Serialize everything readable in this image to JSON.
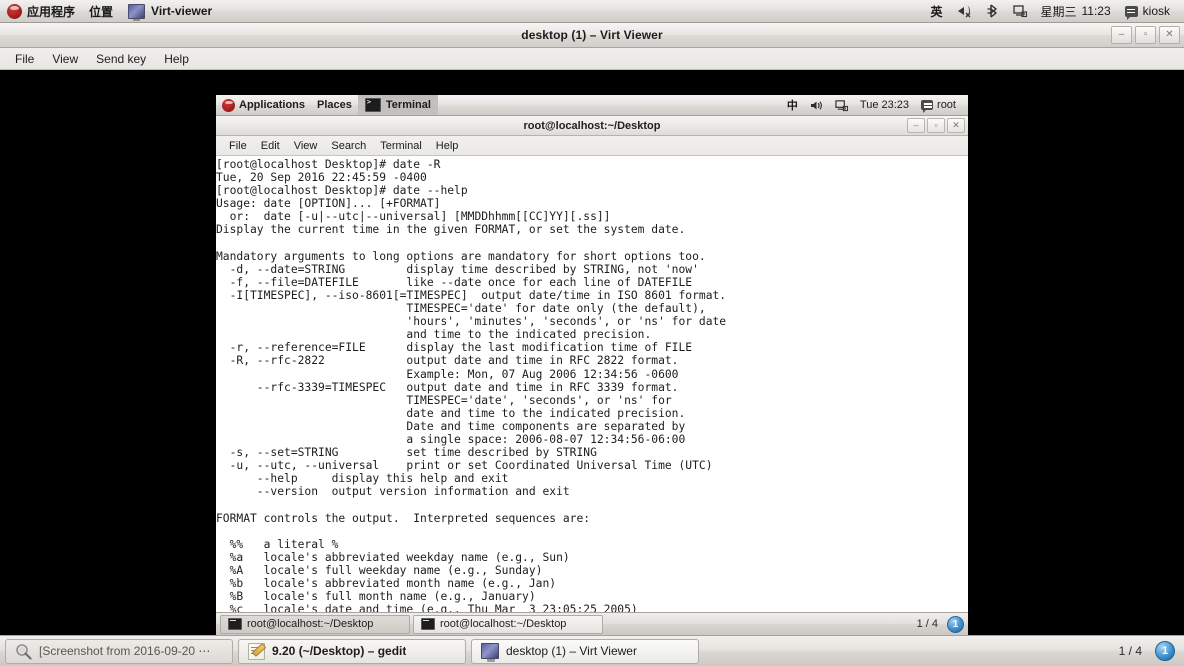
{
  "host_panel": {
    "logo_icon": "fedora-logo-icon",
    "applications_label": "应用程序",
    "places_label": "位置",
    "active_task": "Virt-viewer",
    "active_task_icon": "virt-viewer-icon",
    "input_method": "英",
    "volume_icon": "volume-muted-icon",
    "bluetooth_icon": "bluetooth-icon",
    "network_icon": "network-icon",
    "day_label": "星期三",
    "clock": "11:23",
    "user_icon": "message-icon",
    "user_label": "kiosk"
  },
  "virt_viewer": {
    "title": "desktop (1) – Virt Viewer",
    "window_buttons": {
      "minimize_icon": "minimize-icon",
      "minimize_glyph": "‒",
      "maximize_icon": "maximize-icon",
      "maximize_glyph": "▫",
      "close_icon": "close-icon",
      "close_glyph": "✕"
    },
    "menu": [
      "File",
      "View",
      "Send key",
      "Help"
    ]
  },
  "guest": {
    "panel": {
      "logo_icon": "fedora-logo-icon",
      "applications_label": "Applications",
      "places_label": "Places",
      "active_task": "Terminal",
      "active_task_icon": "terminal-icon",
      "input_method": "中",
      "volume_icon": "volume-icon",
      "network_icon": "network-icon",
      "clock": "Tue 23:23",
      "user_icon": "message-icon",
      "user_label": "root"
    },
    "terminal": {
      "title": "root@localhost:~/Desktop",
      "window_buttons": {
        "minimize_glyph": "‒",
        "maximize_glyph": "▫",
        "close_glyph": "✕"
      },
      "menu": [
        "File",
        "Edit",
        "View",
        "Search",
        "Terminal",
        "Help"
      ],
      "content": "[root@localhost Desktop]# date -R\nTue, 20 Sep 2016 22:45:59 -0400\n[root@localhost Desktop]# date --help\nUsage: date [OPTION]... [+FORMAT]\n  or:  date [-u|--utc|--universal] [MMDDhhmm[[CC]YY][.ss]]\nDisplay the current time in the given FORMAT, or set the system date.\n\nMandatory arguments to long options are mandatory for short options too.\n  -d, --date=STRING         display time described by STRING, not 'now'\n  -f, --file=DATEFILE       like --date once for each line of DATEFILE\n  -I[TIMESPEC], --iso-8601[=TIMESPEC]  output date/time in ISO 8601 format.\n                            TIMESPEC='date' for date only (the default),\n                            'hours', 'minutes', 'seconds', or 'ns' for date\n                            and time to the indicated precision.\n  -r, --reference=FILE      display the last modification time of FILE\n  -R, --rfc-2822            output date and time in RFC 2822 format.\n                            Example: Mon, 07 Aug 2006 12:34:56 -0600\n      --rfc-3339=TIMESPEC   output date and time in RFC 3339 format.\n                            TIMESPEC='date', 'seconds', or 'ns' for\n                            date and time to the indicated precision.\n                            Date and time components are separated by\n                            a single space: 2006-08-07 12:34:56-06:00\n  -s, --set=STRING          set time described by STRING\n  -u, --utc, --universal    print or set Coordinated Universal Time (UTC)\n      --help     display this help and exit\n      --version  output version information and exit\n\nFORMAT controls the output.  Interpreted sequences are:\n\n  %%   a literal %\n  %a   locale's abbreviated weekday name (e.g., Sun)\n  %A   locale's full weekday name (e.g., Sunday)\n  %b   locale's abbreviated month name (e.g., Jan)\n  %B   locale's full month name (e.g., January)\n  %c   locale's date and time (e.g., Thu Mar  3 23:05:25 2005)"
    },
    "taskbar": {
      "tasks": [
        {
          "label": "root@localhost:~/Desktop",
          "icon": "terminal-icon",
          "state": "active"
        },
        {
          "label": "root@localhost:~/Desktop",
          "icon": "terminal-icon",
          "state": "inactive"
        }
      ],
      "pager_label": "1 / 4",
      "pager_number": "1"
    }
  },
  "host_taskbar": {
    "tasks": [
      {
        "label": "[Screenshot from 2016-09-20 ⋯",
        "icon": "screenshot-icon",
        "state": "minimized"
      },
      {
        "label": "9.20 (~/Desktop) – gedit",
        "icon": "gedit-icon",
        "state": "normal"
      },
      {
        "label": "desktop (1) – Virt Viewer",
        "icon": "virt-viewer-icon",
        "state": "active"
      }
    ],
    "pager_label": "1 / 4",
    "pager_number": "1"
  }
}
